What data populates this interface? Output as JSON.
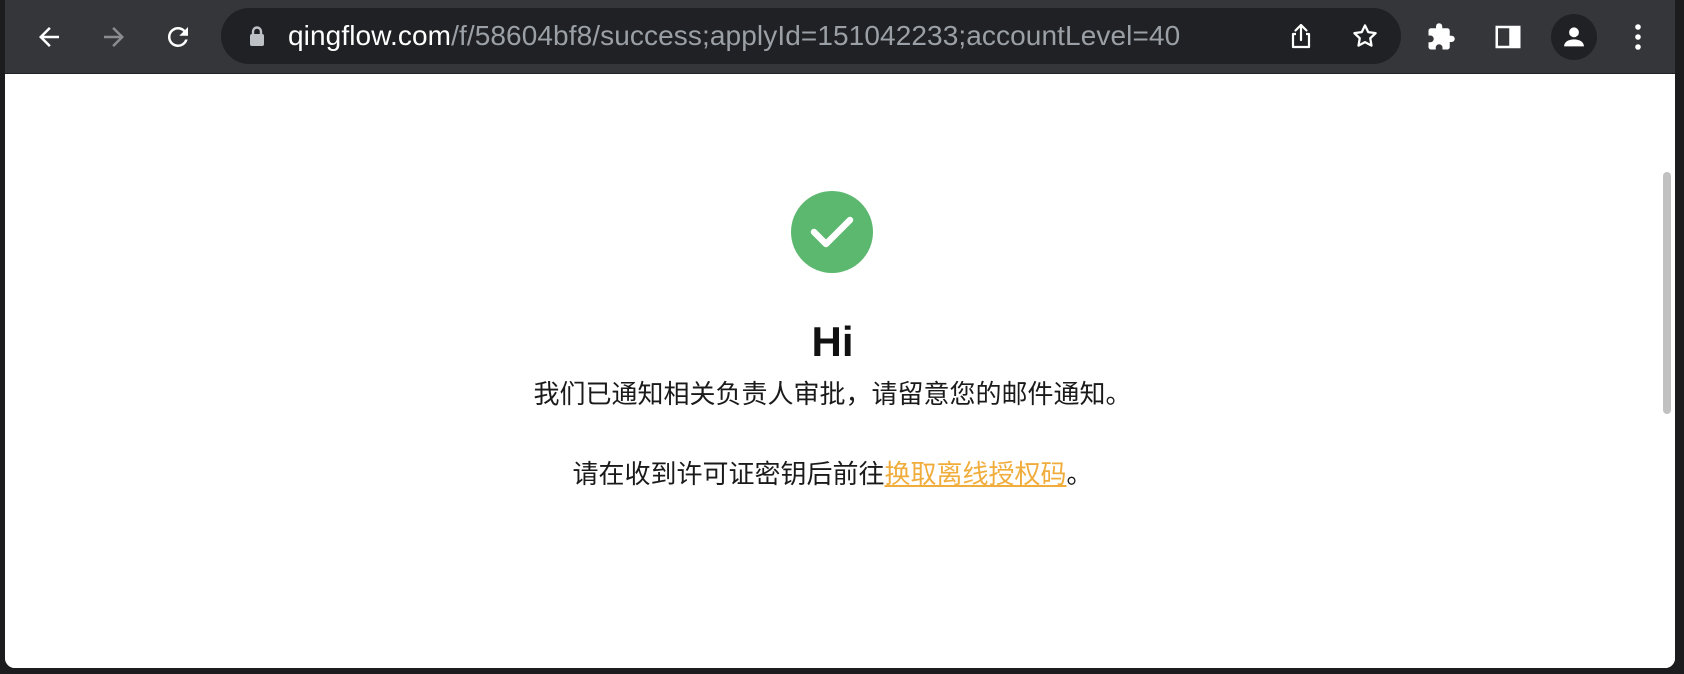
{
  "browser": {
    "url_host": "qingflow.com",
    "url_path": "/f/58604bf8/success;applyId=151042233;accountLevel=40",
    "icons": {
      "back": "back-arrow-icon",
      "forward": "forward-arrow-icon",
      "reload": "reload-icon",
      "lock": "lock-icon",
      "share": "share-icon",
      "bookmark": "star-icon",
      "extensions": "puzzle-icon",
      "side_panel": "side-panel-icon",
      "profile": "profile-icon",
      "menu": "kebab-menu-icon"
    }
  },
  "page": {
    "status_icon": "checkmark-icon",
    "status_color": "#5cb86e",
    "greeting": "Hi",
    "notice": "我们已通知相关负责人审批，请留意您的邮件通知。",
    "instruction_prefix": "请在收到许可证密钥后前往",
    "instruction_link": "换取离线授权码",
    "instruction_suffix": "。",
    "link_color": "#f0ad3c"
  }
}
